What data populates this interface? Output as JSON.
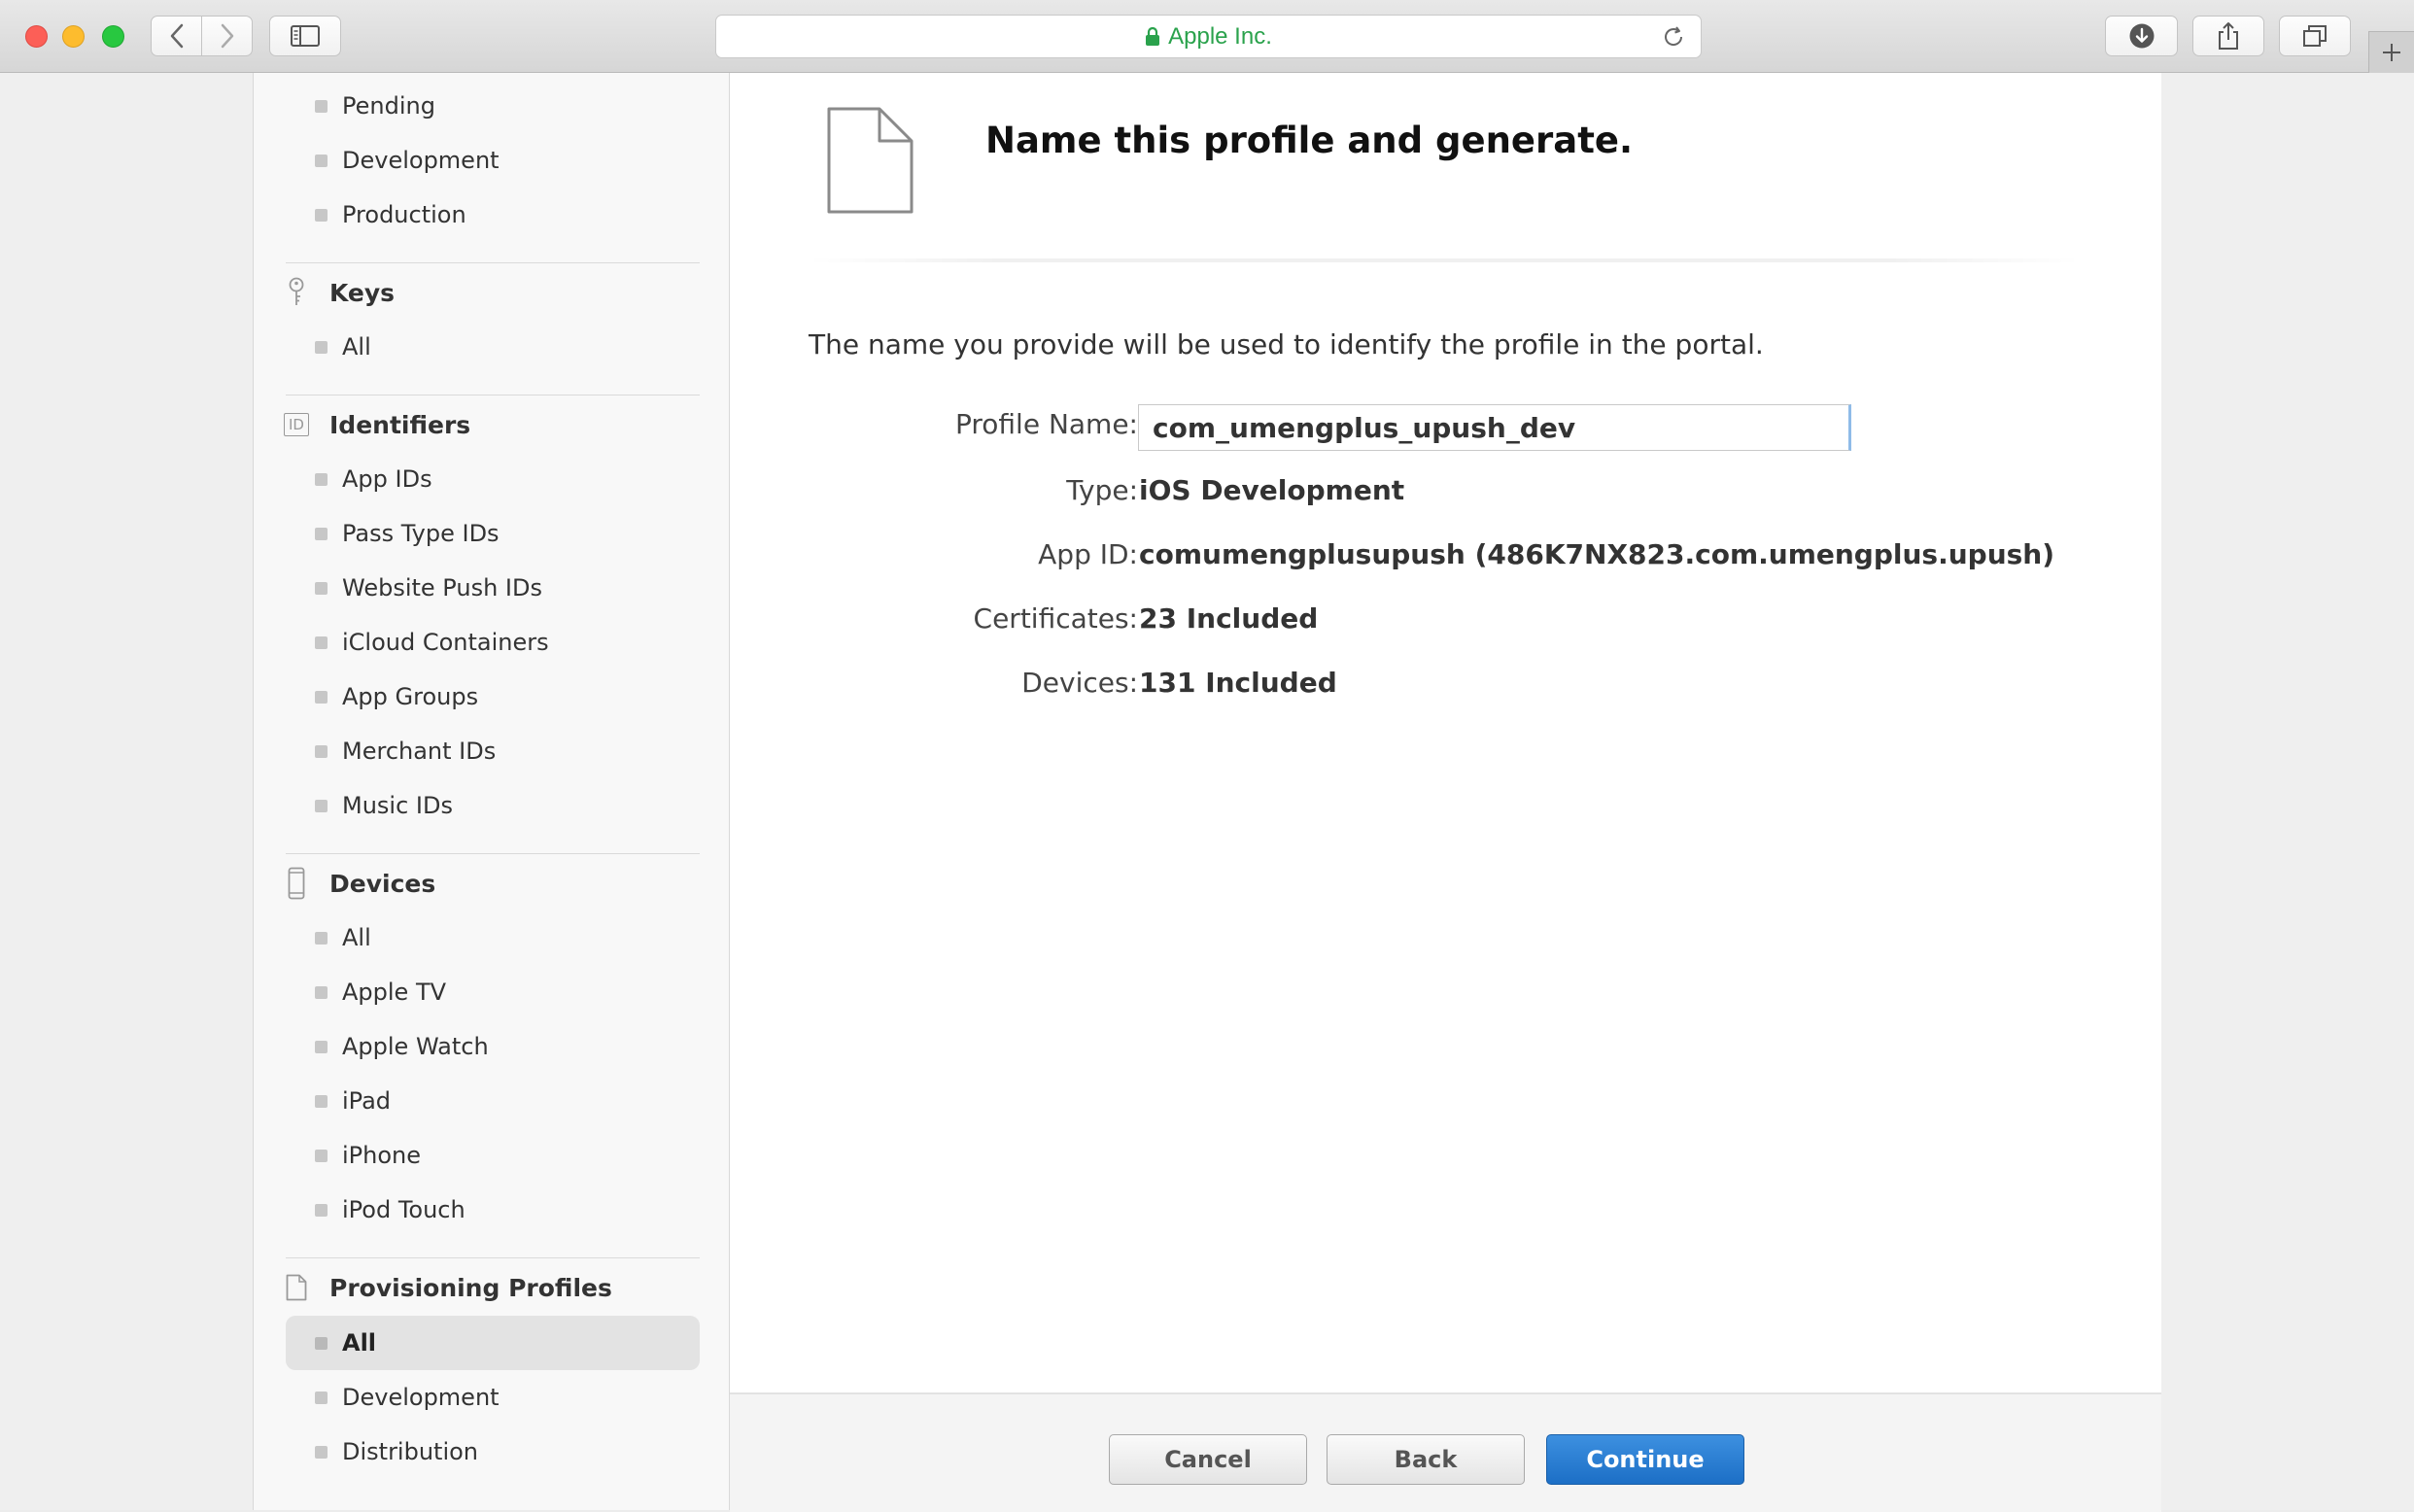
{
  "browser": {
    "url_label": "Apple Inc."
  },
  "sidebar": {
    "certs_items": [
      "Pending",
      "Development",
      "Production"
    ],
    "keys": {
      "heading": "Keys",
      "items": [
        "All"
      ]
    },
    "identifiers": {
      "heading": "Identifiers",
      "icon_text": "ID",
      "items": [
        "App IDs",
        "Pass Type IDs",
        "Website Push IDs",
        "iCloud Containers",
        "App Groups",
        "Merchant IDs",
        "Music IDs"
      ]
    },
    "devices": {
      "heading": "Devices",
      "items": [
        "All",
        "Apple TV",
        "Apple Watch",
        "iPad",
        "iPhone",
        "iPod Touch"
      ]
    },
    "profiles": {
      "heading": "Provisioning Profiles",
      "items": [
        "All",
        "Development",
        "Distribution"
      ],
      "active": "All"
    }
  },
  "main": {
    "title": "Name this profile and generate.",
    "intro": "The name you provide will be used to identify the profile in the portal.",
    "profile_name": {
      "label": "Profile Name:",
      "value": "com_umengplus_upush_dev"
    },
    "type": {
      "label": "Type:",
      "value": "iOS Development"
    },
    "app_id": {
      "label": "App ID:",
      "value": "comumengplusupush (486K7NX823.com.umengplus.upush)"
    },
    "certificates": {
      "label": "Certificates:",
      "value": "23 Included"
    },
    "devices": {
      "label": "Devices:",
      "value": "131 Included"
    }
  },
  "footer": {
    "cancel": "Cancel",
    "back": "Back",
    "continue": "Continue"
  },
  "colors": {
    "url_green": "#2aa24c",
    "continue_blue": "#1c6fc6"
  }
}
